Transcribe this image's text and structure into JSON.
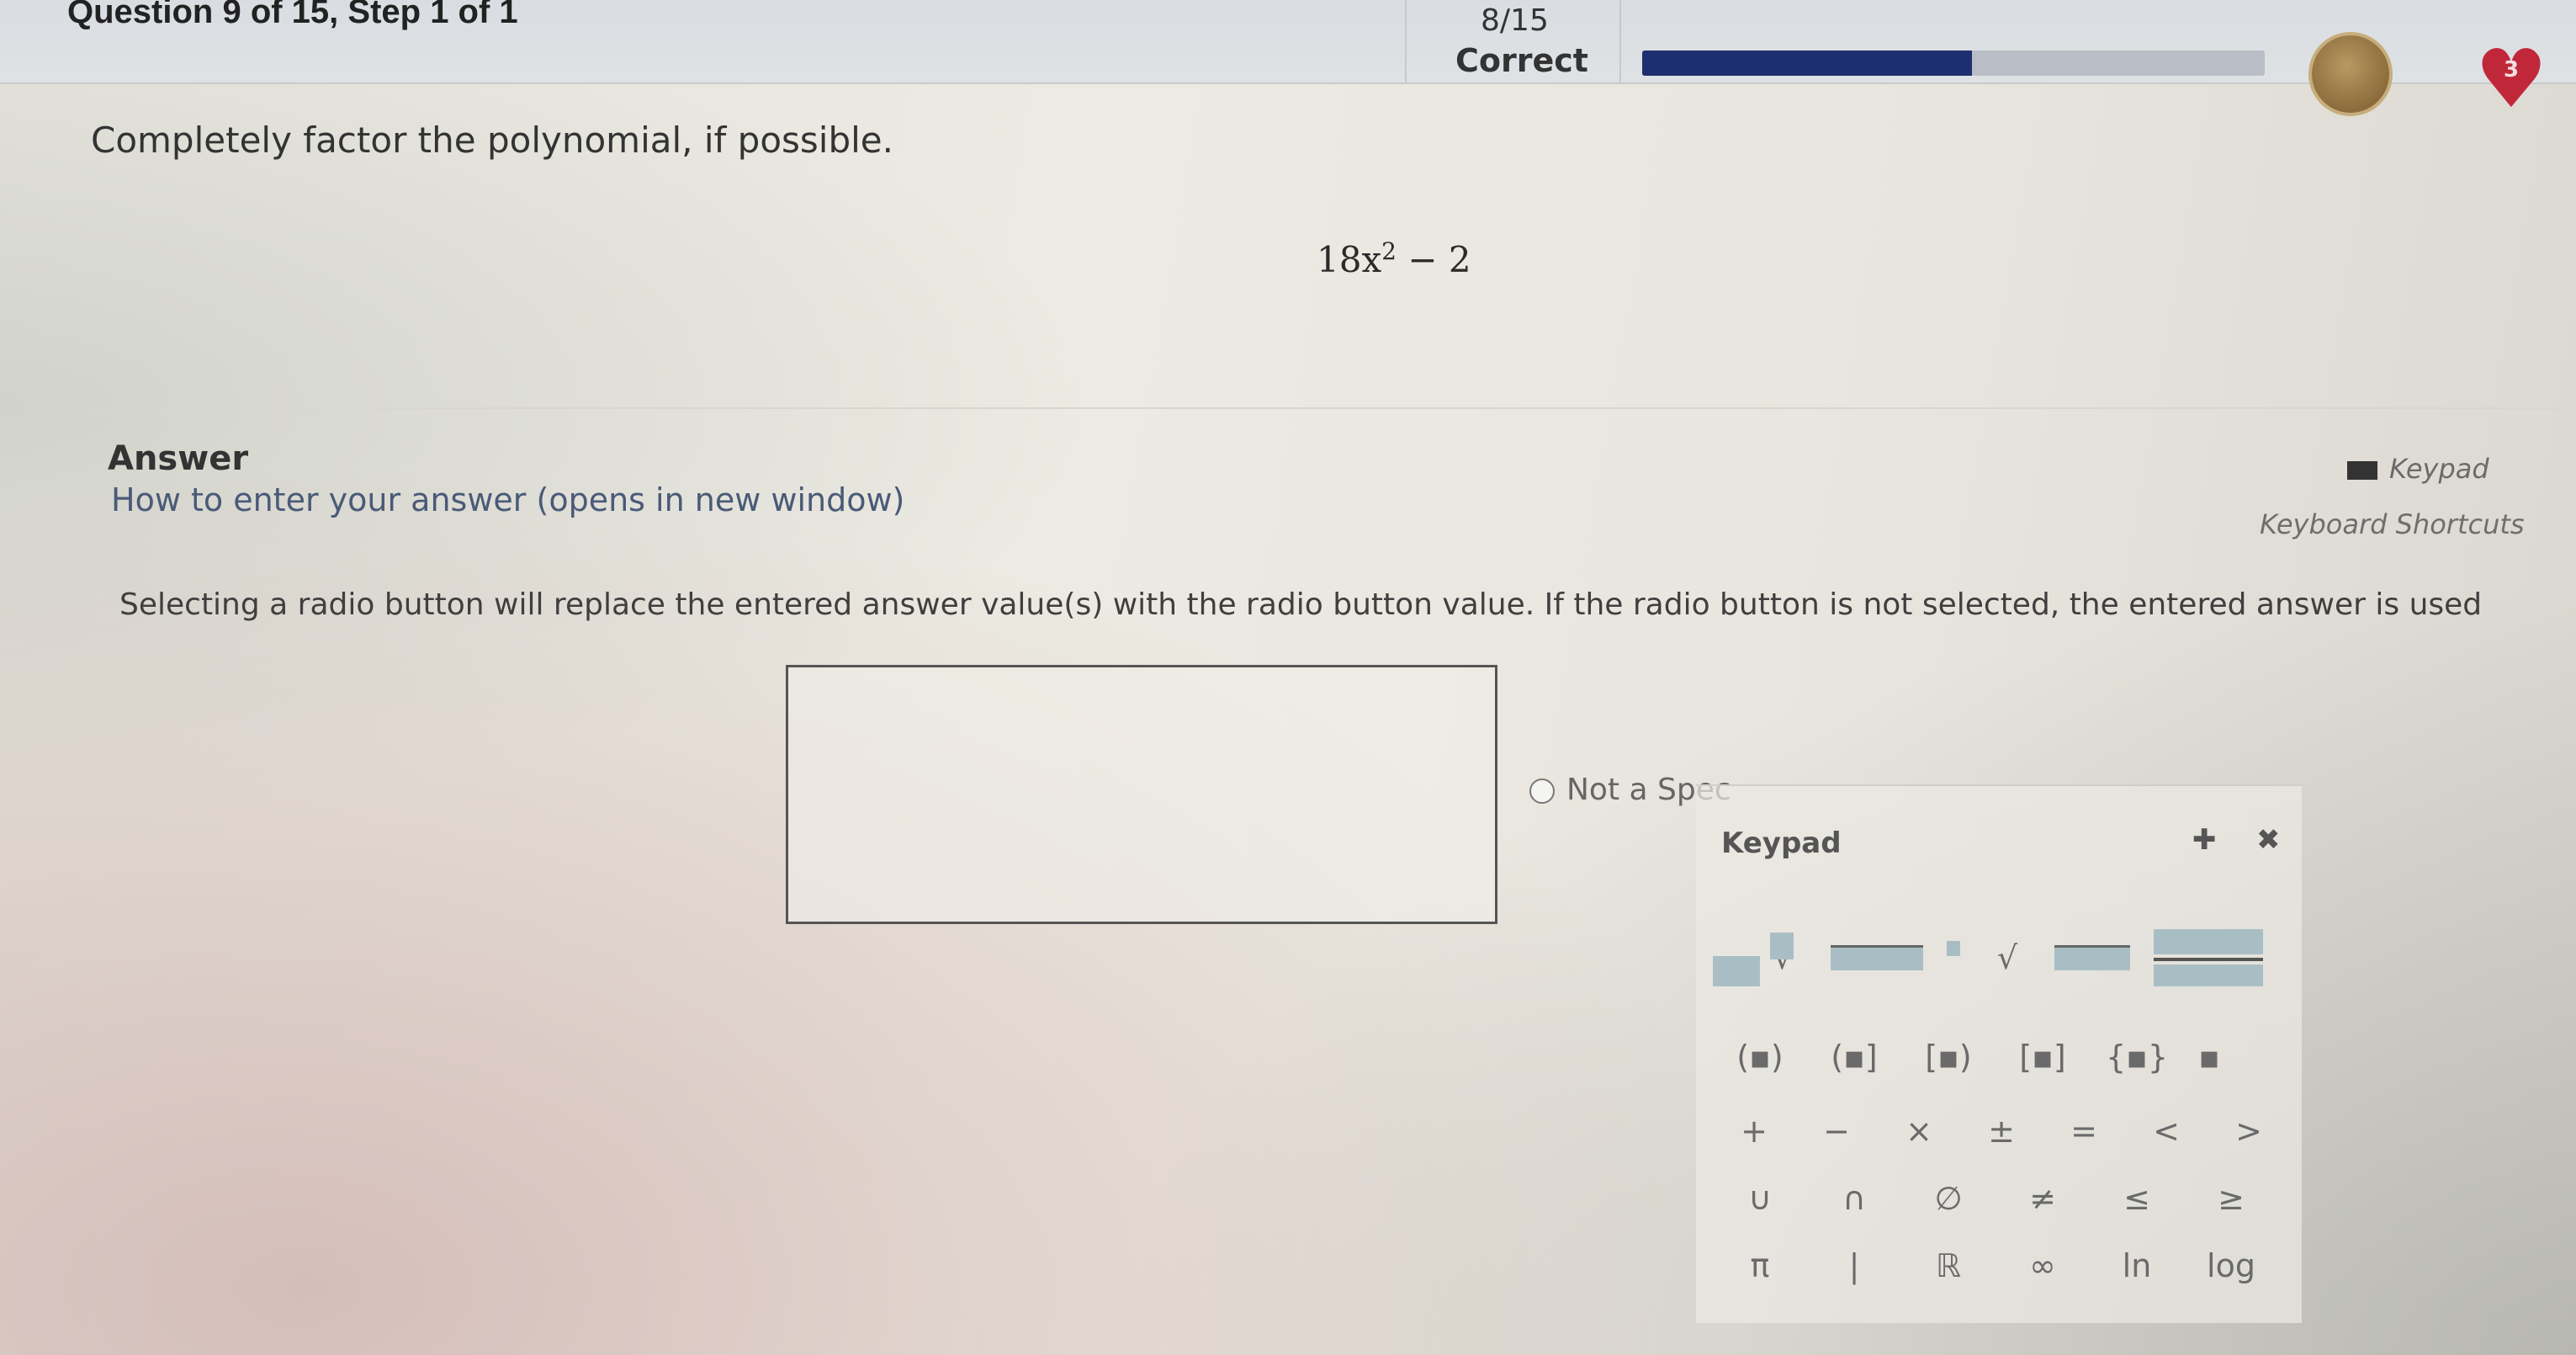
{
  "header": {
    "question_title": "Question 9 of 15, Step 1 of 1",
    "score": "8/15",
    "status": "Correct",
    "progress_fraction": 0.53,
    "lives": "3",
    "colors": {
      "progress": "#1d2f6f",
      "heart": "#c0283a"
    }
  },
  "question": {
    "prompt": "Completely factor the polynomial, if possible.",
    "expression_coef": "18x",
    "expression_exp": "2",
    "expression_rest": " − 2"
  },
  "answer": {
    "label": "Answer",
    "how_to": "How to enter your answer (opens in new window)",
    "keypad_link": "Keypad",
    "shortcuts_link": "Keyboard Shortcuts",
    "instructions": "Selecting a radio button will replace the entered answer value(s) with the radio button value. If the radio button is not selected, the entered answer is used",
    "input_value": "",
    "radio_label": "Not a Spec"
  },
  "keypad": {
    "title": "Keypad",
    "move_icon": "move-icon",
    "close_icon": "close-icon",
    "row2": [
      "(▪)",
      "(▪]",
      "[▪)",
      "[▪]",
      "{▪}",
      "▪"
    ],
    "row3": [
      "+",
      "−",
      "×",
      "±",
      "=",
      "<",
      ">"
    ],
    "row4": [
      "∪",
      "∩",
      "∅",
      "≠",
      "≤",
      "≥"
    ],
    "row5": [
      "π",
      "|",
      "ℝ",
      "∞",
      "ln",
      "log"
    ]
  }
}
